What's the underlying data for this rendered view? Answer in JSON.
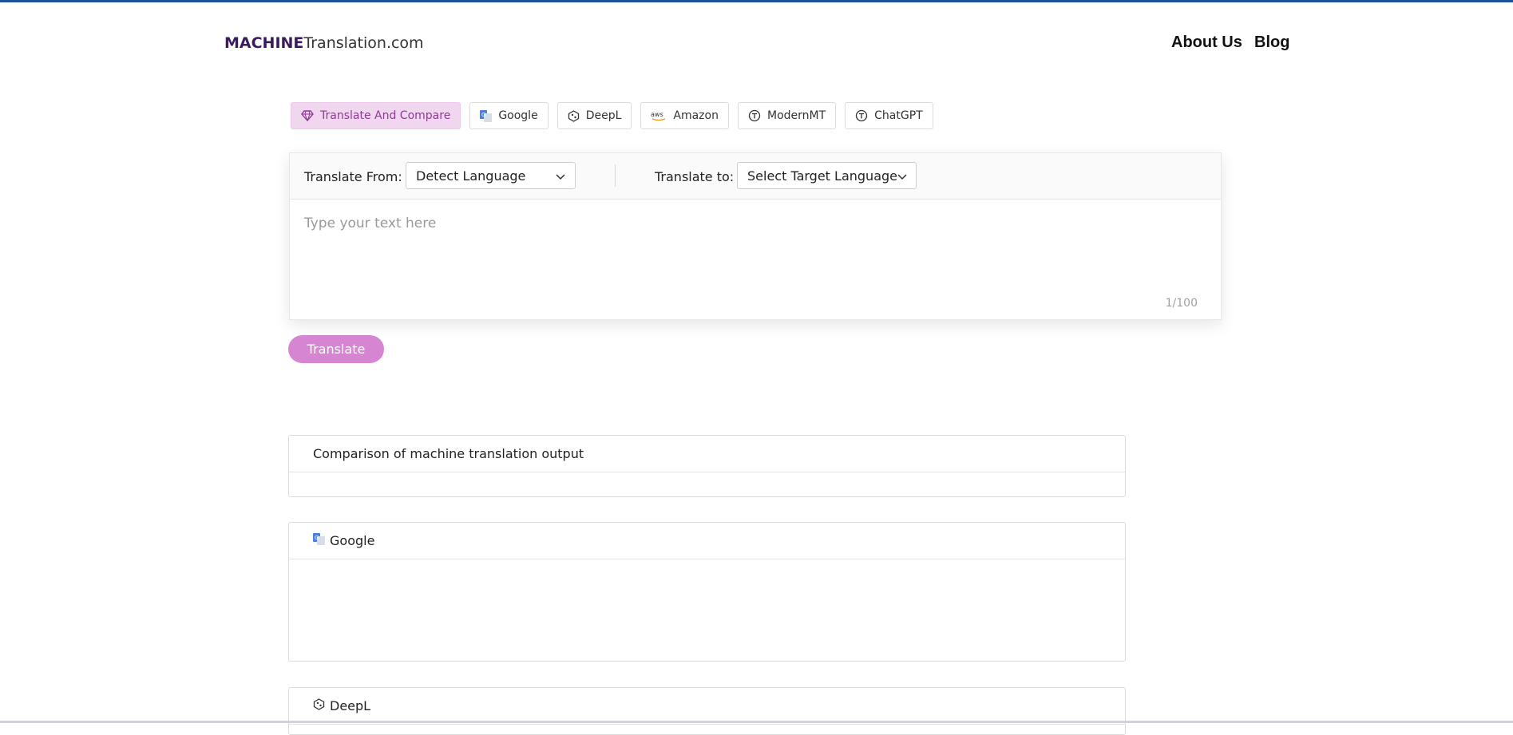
{
  "header": {
    "logo_bold": "MACHINE",
    "logo_light": "Translation.com",
    "nav": [
      "About Us",
      "Blog"
    ]
  },
  "tabs": [
    {
      "label": "Translate And Compare",
      "icon": "gem-icon",
      "active": true
    },
    {
      "label": "Google",
      "icon": "google-translate-icon",
      "active": false
    },
    {
      "label": "DeepL",
      "icon": "deepl-icon",
      "active": false
    },
    {
      "label": "Amazon",
      "icon": "aws-icon",
      "active": false
    },
    {
      "label": "ModernMT",
      "icon": "modernmt-icon",
      "active": false
    },
    {
      "label": "ChatGPT",
      "icon": "chatgpt-icon",
      "active": false
    }
  ],
  "translator": {
    "from_label": "Translate From:",
    "from_value": "Detect Language",
    "to_label": "Translate to:",
    "to_value": "Select Target Language",
    "placeholder": "Type your text here",
    "counter": "1/100"
  },
  "translate_button": "Translate",
  "panels": {
    "compare_title": "Comparison of machine translation output",
    "google_title": "Google",
    "deepl_title": "DeepL"
  },
  "colors": {
    "accent": "#d685d2",
    "active_tab_bg": "#f0d6ee",
    "logo": "#3b1a5e",
    "top_bar": "#1f4f9c"
  }
}
